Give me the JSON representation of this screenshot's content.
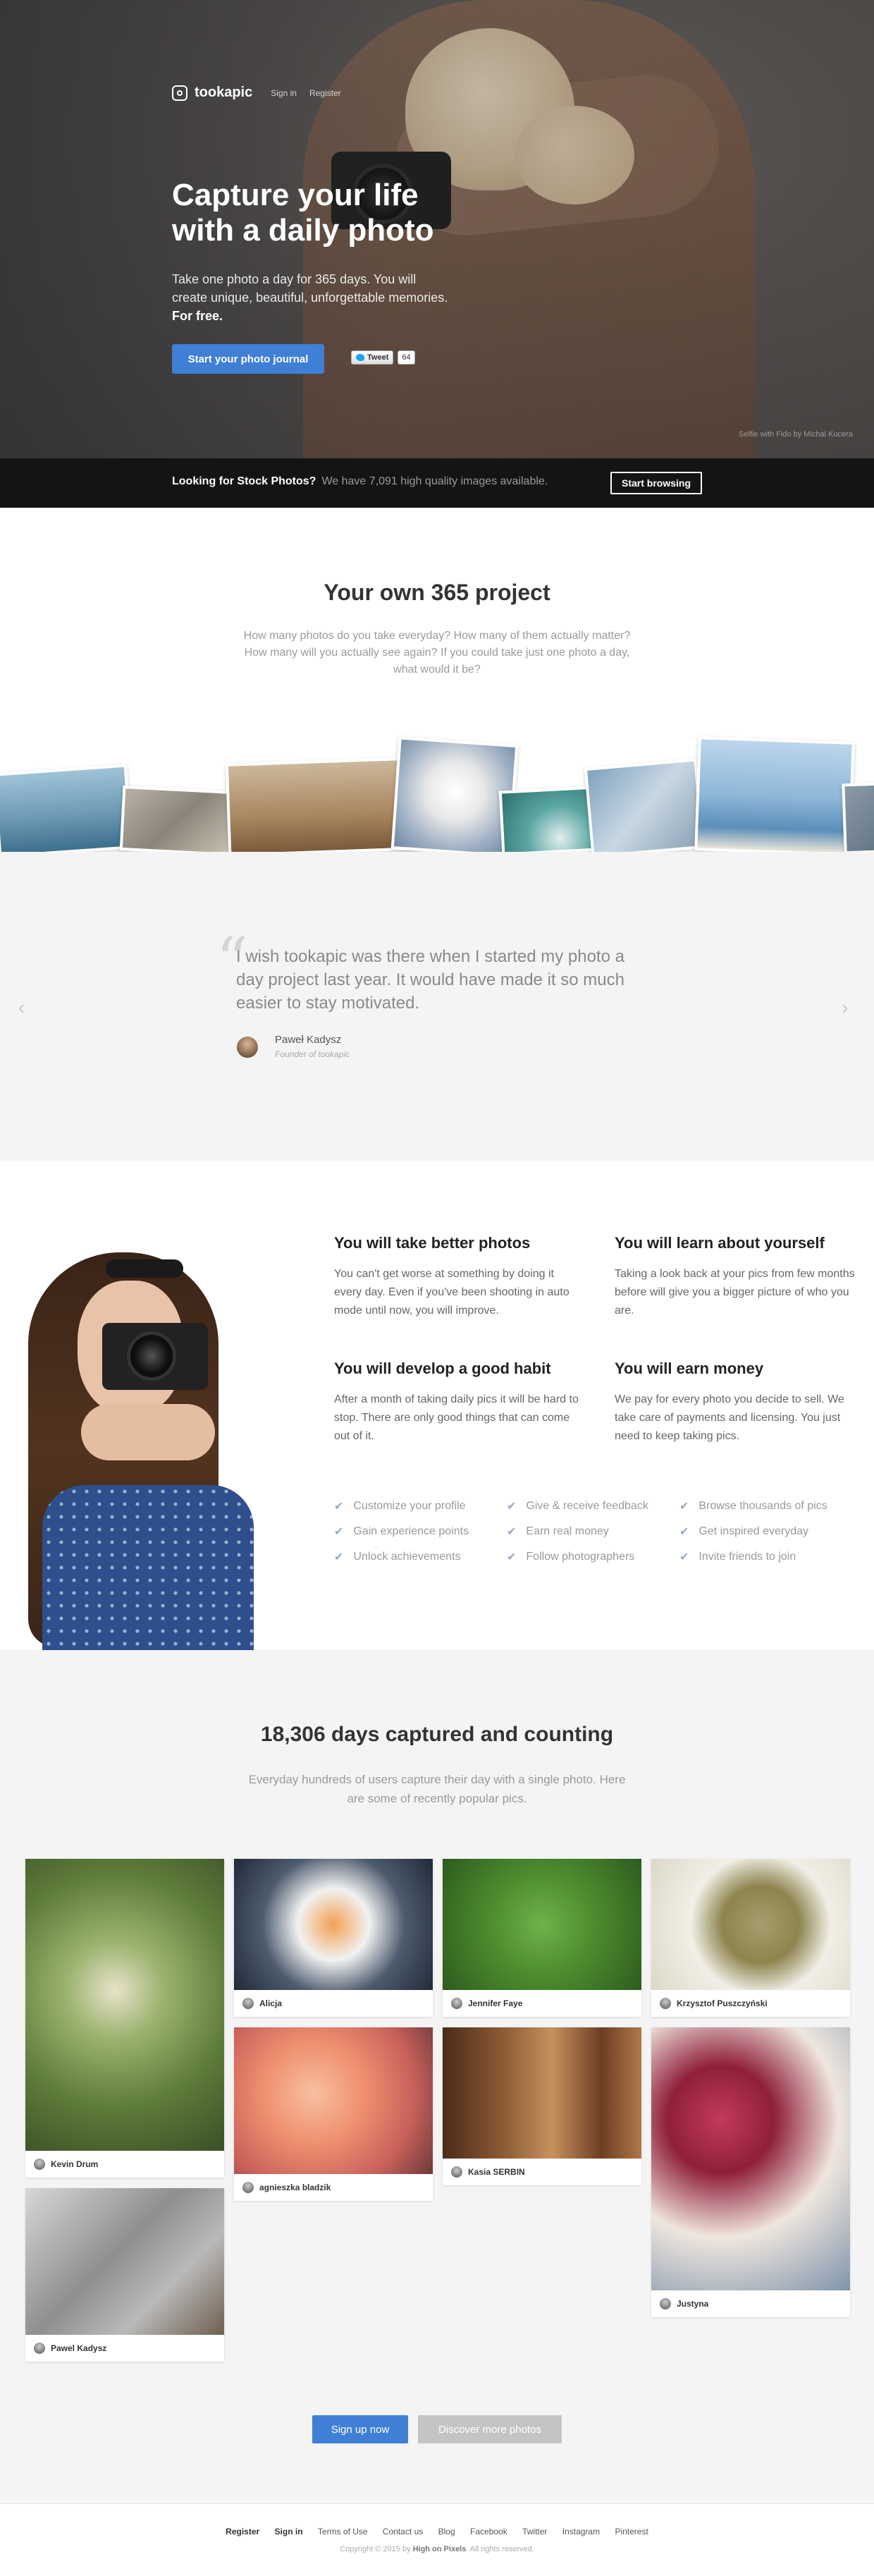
{
  "nav": {
    "logo": "tookapic",
    "sign_in": "Sign in",
    "register": "Register"
  },
  "hero": {
    "title": "Capture your life with a daily photo",
    "subtitle": "Take one photo a day for 365 days. You will create unique, beautiful, unforgettable memories.",
    "subtitle_bold": "For free.",
    "cta": "Start your photo journal",
    "tweet_label": "Tweet",
    "tweet_count": "64",
    "credit": "Selfie with Fido by Michal Kucera"
  },
  "stock": {
    "bold": "Looking for Stock Photos?",
    "text": "We have 7,091 high quality images available.",
    "button": "Start browsing"
  },
  "intro": {
    "title": "Your own 365 project",
    "body": "How many photos do you take everyday? How many of them actually matter? How many will you actually see again? If you could take just one photo a day, what would it be?"
  },
  "testimonial": {
    "quote": "I wish tookapic was there when I started my photo a day project last year. It would have made it so much easier to stay motivated.",
    "author": "Paweł Kadysz",
    "role": "Founder of tookapic",
    "prev": "‹",
    "next": "›"
  },
  "features": [
    {
      "title": "You will take better photos",
      "body": "You can't get worse at something by doing it every day. Even if you've been shooting in auto mode until now, you will improve."
    },
    {
      "title": "You will learn about yourself",
      "body": "Taking a look back at your pics from few months before will give you a bigger picture of who you are."
    },
    {
      "title": "You will develop a good habit",
      "body": "After a month of taking daily pics it will be hard to stop. There are only good things that can come out of it."
    },
    {
      "title": "You will earn money",
      "body": "We pay for every photo you decide to sell. We take care of payments and licensing. You just need to keep taking pics."
    }
  ],
  "checklist": [
    "Customize your profile",
    "Give & receive feedback",
    "Browse thousands of pics",
    "Gain experience points",
    "Earn real money",
    "Get inspired everyday",
    "Unlock achievements",
    "Follow photographers",
    "Invite friends to join"
  ],
  "gallery": {
    "title": "18,306 days captured and counting",
    "body": "Everyday hundreds of users capture their day with a single photo. Here are some of recently popular pics.",
    "cards": [
      {
        "user": "Kevin Drum",
        "color": "#6f8f4a"
      },
      {
        "user": "Pawel Kadysz",
        "color": "#9c9c9c"
      },
      {
        "user": "Alicja",
        "color": "#2f3b4f"
      },
      {
        "user": "agnieszka bladzik",
        "color": "#e69a7b"
      },
      {
        "user": "Jennifer Faye",
        "color": "#5fa03a"
      },
      {
        "user": "Kasia SERBIN",
        "color": "#7a4a2c"
      },
      {
        "user": "Krzysztof Puszczyński",
        "color": "#a7a07a"
      },
      {
        "user": "Justyna",
        "color": "#8a6a7a"
      }
    ],
    "signup": "Sign up now",
    "discover": "Discover more photos"
  },
  "footer": {
    "links": [
      "Register",
      "Sign in",
      "Terms of Use",
      "Contact us",
      "Blog",
      "Facebook",
      "Twitter",
      "Instagram",
      "Pinterest"
    ],
    "copy_prefix": "Copyright © 2015 by",
    "copy_brand": "High on Pixels",
    "copy_suffix": ". All rights reserved."
  }
}
